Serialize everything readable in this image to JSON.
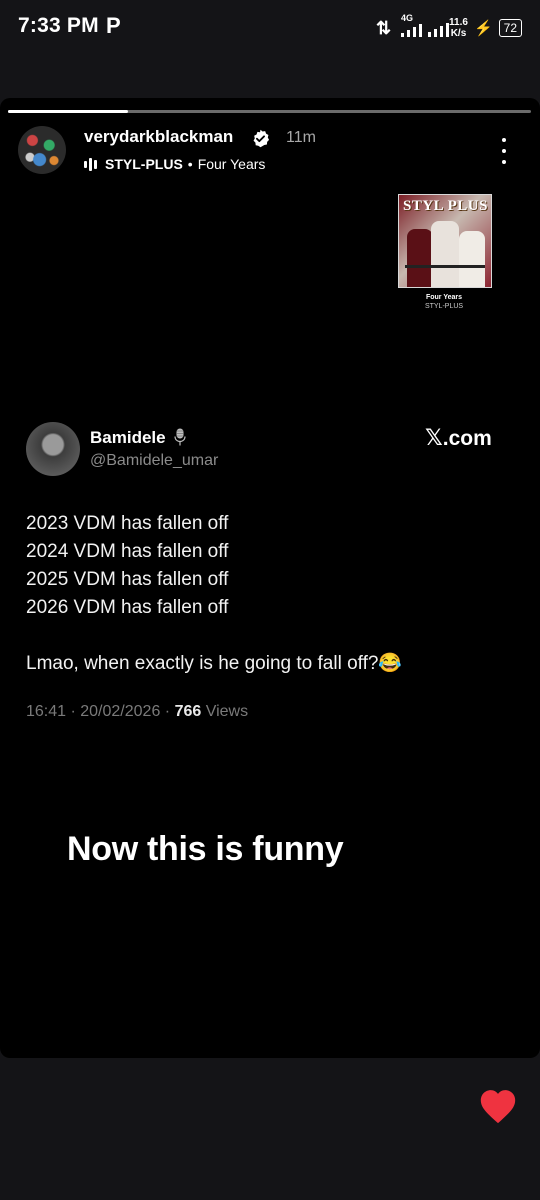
{
  "status_bar": {
    "time": "7:33 PM",
    "notification_icon": "P",
    "network_type": "4G",
    "speed_value": "11.6",
    "speed_unit": "K/s",
    "battery": "72"
  },
  "story": {
    "progress": 0.23,
    "username": "verydarkblackman",
    "time_ago": "11m",
    "music_artist": "STYL-PLUS",
    "music_separator": "•",
    "music_title": "Four Years",
    "album_sticker": {
      "logo_text": "STYL PLUS",
      "caption_title": "Four Years",
      "caption_artist": "STYL-PLUS"
    },
    "tweet": {
      "name": "Bamidele",
      "handle": "@Bamidele_umar",
      "source": "com",
      "lines": [
        "2023 VDM has fallen off",
        "2024 VDM has fallen off",
        "2025 VDM has fallen off",
        "2026 VDM has fallen off",
        "",
        "Lmao, when exactly is he going to fall off?😂"
      ],
      "timestamp": "16:41 · 20/02/2026 · ",
      "views_count": "766",
      "views_label": " Views"
    },
    "caption": "Now this is funny"
  },
  "icons": {
    "verified": "verified-badge-icon",
    "more": "more-vertical-icon",
    "music": "audio-wave-icon",
    "like": "heart-icon",
    "x_logo": "x-logo-icon"
  },
  "colors": {
    "background": "#141417",
    "card": "#000000",
    "heart": "#ef3340",
    "muted_text": "#7a7a7a"
  }
}
